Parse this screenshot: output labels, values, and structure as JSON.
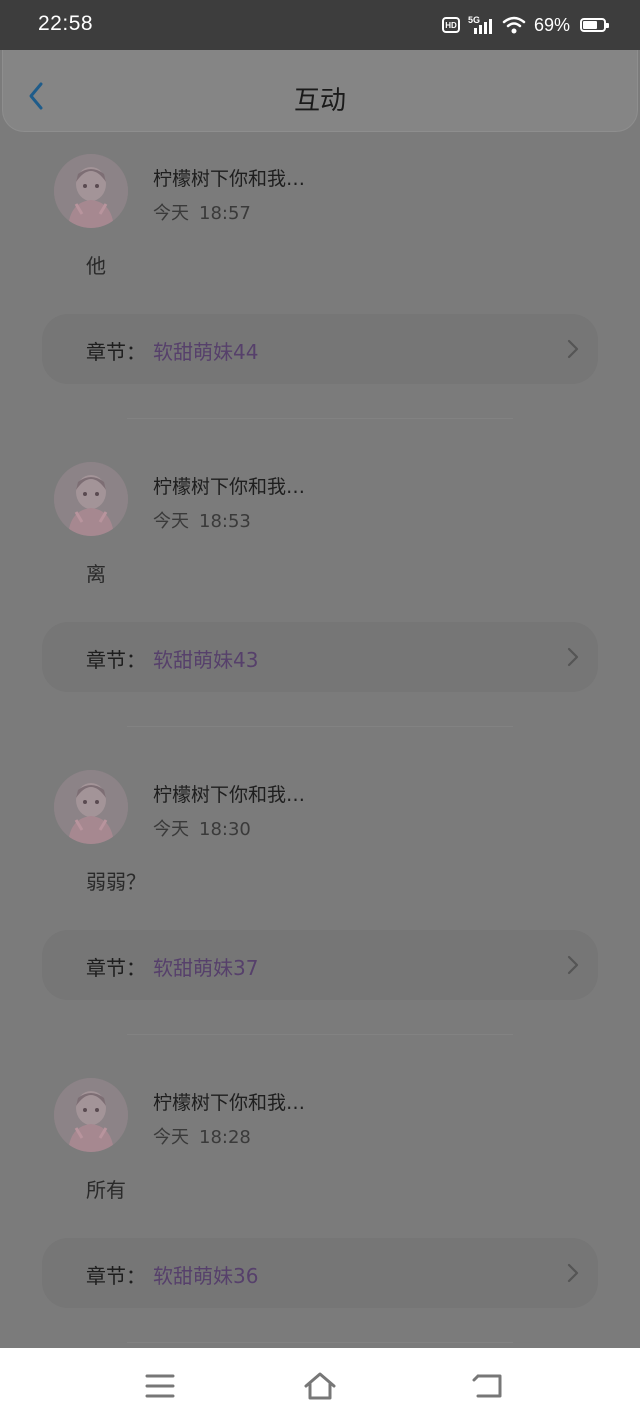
{
  "status_bar": {
    "time": "22:58",
    "hd_label": "HD",
    "network_label": "5G",
    "battery_percent": "69%",
    "battery_level": 0.69
  },
  "header": {
    "title": "互动",
    "back_icon": "chevron-left-icon"
  },
  "feed": {
    "items": [
      {
        "username": "柠檬树下你和我…",
        "date": "今天",
        "time": "18:57",
        "comment": "他",
        "chapter_label": "章节：",
        "chapter_name": "软甜萌妹44"
      },
      {
        "username": "柠檬树下你和我…",
        "date": "今天",
        "time": "18:53",
        "comment": "离",
        "chapter_label": "章节：",
        "chapter_name": "软甜萌妹43"
      },
      {
        "username": "柠檬树下你和我…",
        "date": "今天",
        "time": "18:30",
        "comment": "弱弱？",
        "chapter_label": "章节：",
        "chapter_name": "软甜萌妹37"
      },
      {
        "username": "柠檬树下你和我…",
        "date": "今天",
        "time": "18:28",
        "comment": "所有",
        "chapter_label": "章节：",
        "chapter_name": "软甜萌妹36"
      }
    ]
  },
  "bottom_nav": {
    "icons": [
      "menu-icon",
      "home-icon",
      "back-icon"
    ]
  },
  "colors": {
    "overlay_background": "#7b7b7b",
    "status_bar": "#3d3d3d",
    "accent_back": "#1f5c8a",
    "chapter_link": "#56406b"
  }
}
